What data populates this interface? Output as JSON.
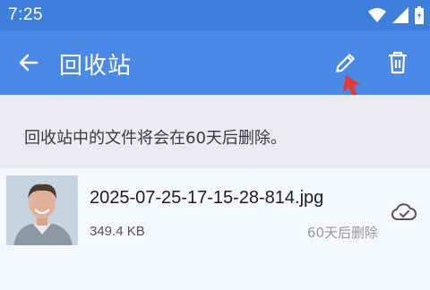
{
  "statusbar": {
    "time": "7:25"
  },
  "appbar": {
    "title": "回收站"
  },
  "notice": {
    "text": "回收站中的文件将会在60天后删除。"
  },
  "files": [
    {
      "name": "2025-07-25-17-15-28-814.jpg",
      "size": "349.4 KB",
      "expiry": "60天后删除"
    }
  ],
  "colors": {
    "statusbar": "#3f7fdc",
    "appbar": "#4a89e6",
    "annotation_arrow": "#e53935"
  },
  "icons": [
    "wifi-icon",
    "signal-icon",
    "battery-icon",
    "back-arrow-icon",
    "pencil-icon",
    "trash-icon",
    "cloud-check-icon"
  ]
}
